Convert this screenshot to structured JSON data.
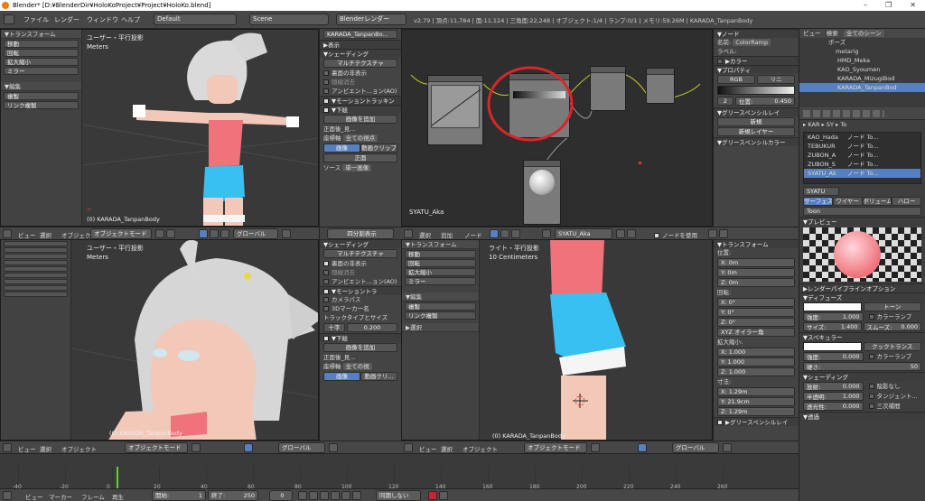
{
  "window": {
    "title": "Blender* [D:¥BlenderDir¥HoloKoProject¥Project¥HoloKo.blend]",
    "controls": [
      "–",
      "❐",
      "✕"
    ]
  },
  "infobar": {
    "menus": [
      "ファイル",
      "レンダー",
      "ウィンドウ",
      "ヘルプ"
    ],
    "layout": "Default",
    "scene": "Scene",
    "engine": "Blenderレンダー",
    "stats": "v2.79 | 頂点:11,784 | 面:11,124 | 三角面:22,248 | オブジェクト:1/4 | ランプ:0/1 | メモリ:59.26M | KARADA_TanpanBody"
  },
  "viewport_tl": {
    "view_label": "ユーザー・平行投影",
    "units": "Meters",
    "object_label": "(0) KARADA_TanpanBody",
    "toolshelf": {
      "transform_header": "▼トランスフォーム",
      "transform_buttons": [
        "移動",
        "回転",
        "拡大縮小",
        "ミラー"
      ],
      "edit_header": "▼編集",
      "edit_buttons": [
        "複製",
        "リンク複製"
      ]
    }
  },
  "viewport_tl_props": {
    "object_field": "KARADA_TanpanBo...",
    "display": "▶表示",
    "shading": "▼シェーディング",
    "shading_mode": "マルチテクスチャ",
    "backface": "裏面の非表示",
    "hidden_wire": "隠線消去",
    "ao": "アンビエント...ョン(AO)",
    "motion_tracking": "▼モーショントラッキン",
    "background": "▼下絵",
    "add_image": "画像を追加",
    "bg_item": "正面後_見...",
    "axis_label": "座標軸",
    "axis_value": "全ての視点",
    "tab_image": "画像",
    "tab_movie": "動画クリップ",
    "front_label": "正面",
    "source_label": "ソース",
    "source_value": "単一画像"
  },
  "node_editor": {
    "node_label": "SYATU_Aka",
    "panel": {
      "title": "▼ノード",
      "name_label": "名前:",
      "name_value": "ColorRamp",
      "label_label": "ラベル:",
      "color_sec": "▶カラー",
      "props_sec": "▼プロパティ",
      "mode": "RGB",
      "interp": "リニ",
      "pos_idx": "2",
      "pos_label": "位置:",
      "pos_value": "0.450"
    }
  },
  "outliner": {
    "tabs": [
      "ビュー",
      "検索",
      "全てのシーン"
    ],
    "items": [
      "ポーズ",
      "metarig",
      "HMD_Meka",
      "KAO_Syoumen",
      "KARADA_MizugiBod",
      "KARADA_TanpanBod"
    ]
  },
  "viewport_bl": {
    "view_label": "ユーザー・平行投影",
    "units": "Meters",
    "object_label": "(0) KARADA_TanpanBody",
    "header": {
      "items": [
        "ビュー",
        "選択",
        "オブジェクト"
      ],
      "mode": "オブジェクトモード",
      "orientation": "グローバル"
    }
  },
  "viewport_bl_props": {
    "quad_toggle": "四分割表示",
    "shading": "▼シェーディング",
    "shading_mode": "マルチテクスチャ",
    "backface": "裏面の非表示",
    "hidden_wire": "隠線消去",
    "ao": "アンビエント...ョン(AO)",
    "motion": "▼モーショントラ",
    "camera_path": "カメラパス",
    "marker_name": "3Dマーカー名",
    "track_type": "トラックタイプとサイズ",
    "track_style": "十字",
    "track_size": "0.200",
    "background": "▼下絵",
    "add_image": "画像を追加",
    "bg_item": "正面後_見...",
    "axis_label": "座標軸",
    "axis_value": "全ての視",
    "tab_image": "画像",
    "tab_movie": "動画クリ..."
  },
  "viewport_br": {
    "view_label": "ライト・平行投影",
    "units": "10 Centimeters",
    "object_label": "(0) KARADA_TanpanBody",
    "toolshelf": {
      "transform_header": "▼トランスフォーム",
      "transform_buttons": [
        "移動",
        "回転",
        "拡大縮小",
        "ミラー"
      ],
      "edit_header": "▼編集",
      "edit_buttons": [
        "複製",
        "リンク複製"
      ]
    },
    "header": {
      "items": [
        "ビュー",
        "選択",
        "オブジェクト"
      ],
      "mode": "オブジェクトモード",
      "orientation": "グローバル"
    }
  },
  "node_header": {
    "items": [
      "選択",
      "追加",
      "ノード"
    ],
    "material": "SYATU_Aka",
    "use_nodes": "ノードを使用"
  },
  "transform_panel": {
    "title": "▼トランスフォーム",
    "location": "位置:",
    "loc": [
      "X:        0m",
      "Y:        0m",
      "Z:        0m"
    ],
    "rotation": "回転:",
    "rot": [
      "X:        0°",
      "Y:        0°",
      "Z:        0°"
    ],
    "rotation_mode": "XYZ オイラー角",
    "scale": "拡大縮小:",
    "scl": [
      "X:     1.000",
      "Y:     1.000",
      "Z:     1.000"
    ],
    "dims": "寸法:",
    "dim": [
      "X:      1.29m",
      "Y:      21.9cm",
      "Z:      1.29m"
    ],
    "grease": "▶グリースペンシルレイ"
  },
  "material_panel": {
    "tabs": [
      "KAR",
      "SY",
      "To"
    ],
    "slots": [
      "KAO_Hada",
      "TEBUKUR",
      "ZUBON_A",
      "ZUBON_S",
      "SYATU_Ak"
    ],
    "slot_subs": [
      "ノード To...",
      "ノード To...",
      "ノード To...",
      "ノード To...",
      "ノード To..."
    ],
    "material_name": "SYATU",
    "shader_tabs": [
      "サーフェス",
      "ワイヤー",
      "ボリューム",
      "ハロー"
    ],
    "shader_label": "Toon",
    "preview": "▼プレビュー",
    "render_pipeline": "▶レンダーパイプラインオプション",
    "diffuse": "▼ディフューズ",
    "diffuse_shader": "トーン",
    "intensity_label": "強度:",
    "intensity": "1.000",
    "colorramp": "カラーランプ",
    "size_label": "サイズ:",
    "size": "1.400",
    "smooth_label": "スムーズ:",
    "smooth": "0.000",
    "specular": "▼スペキュラー",
    "spec_shader": "クックトランス",
    "spec_int_label": "強度:",
    "spec_int": "0.000",
    "hardness_label": "硬さ:",
    "hardness": "50",
    "shading": "▼シェーディング",
    "emit_label": "放射:",
    "emit": "0.000",
    "shadeless": "陰影なし",
    "translucency_label": "半透明:",
    "translucency": "1.000",
    "tangent": "タンジェント...",
    "ambient_label": "透光性:",
    "ambient": "0.000",
    "cubic": "三次補間",
    "transparency": "▼透過"
  },
  "node_props_mid": {
    "grease": "▼グリースペンシルレイ",
    "new": "新規",
    "new_layer": "新規レイヤー",
    "grease_color": "▼グリースペンシルカラー"
  },
  "timeline": {
    "ticks": [
      "-40",
      "-20",
      "0",
      "20",
      "40",
      "60",
      "80",
      "100",
      "120",
      "140",
      "160",
      "180",
      "200",
      "220",
      "240",
      "260"
    ],
    "footer_items": [
      "ビュー",
      "マーカー",
      "フレーム",
      "再生"
    ],
    "start_label": "開始:",
    "start": "1",
    "end_label": "終了:",
    "end": "250",
    "current": "0",
    "sync": "同期しない"
  },
  "colors": {
    "highlight_circle": "#d8262a",
    "accent_blue": "#5680c2",
    "skin": "#f2c9b8",
    "shirt": "#f0727a",
    "shorts": "#38c0f0",
    "hair": "#dadada"
  }
}
